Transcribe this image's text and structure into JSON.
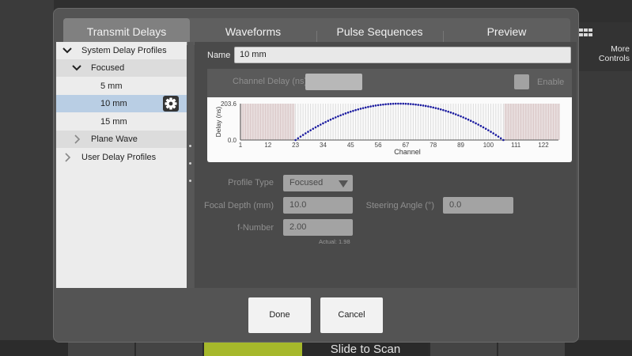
{
  "background": {
    "more_controls": "More Controls",
    "slide_to_scan": "Slide to Scan"
  },
  "tabs": [
    "Transmit Delays",
    "Waveforms",
    "Pulse Sequences",
    "Preview"
  ],
  "tree": {
    "system_delay_profiles": "System Delay Profiles",
    "focused": "Focused",
    "items": [
      "5 mm",
      "10 mm",
      "15 mm"
    ],
    "plane_wave": "Plane Wave",
    "user_delay_profiles": "User Delay Profiles"
  },
  "editor": {
    "name_label": "Name",
    "name_value": "10 mm",
    "channel_delay_label": "Channel Delay (ns)",
    "enable_label": "Enable",
    "profile_type_label": "Profile Type",
    "profile_type_value": "Focused",
    "focal_depth_label": "Focal Depth (mm)",
    "focal_depth_value": "10.0",
    "steering_angle_label": "Steering Angle (°)",
    "steering_angle_value": "0.0",
    "f_number_label": "f-Number",
    "f_number_value": "2.00",
    "actual_text": "Actual: 1.98"
  },
  "chart_data": {
    "type": "scatter",
    "xlabel": "Channel",
    "ylabel": "Delay (ns)",
    "ylim": [
      0.0,
      203.6
    ],
    "y_tick_labels": [
      "203.6",
      "0.0"
    ],
    "x_tick_labels": [
      "1",
      "12",
      "23",
      "34",
      "45",
      "56",
      "67",
      "78",
      "89",
      "100",
      "111",
      "122"
    ],
    "xlim": [
      1,
      128
    ],
    "active_channels": [
      23,
      106
    ],
    "series": [
      {
        "color": "#1a1a9e",
        "shape": "parabola",
        "x_start": 23,
        "x_end": 106,
        "y_at_ends": 0.0,
        "y_peak": 203.6
      }
    ],
    "inactive_color": "#d9c6c6"
  },
  "buttons": {
    "done": "Done",
    "cancel": "Cancel"
  }
}
